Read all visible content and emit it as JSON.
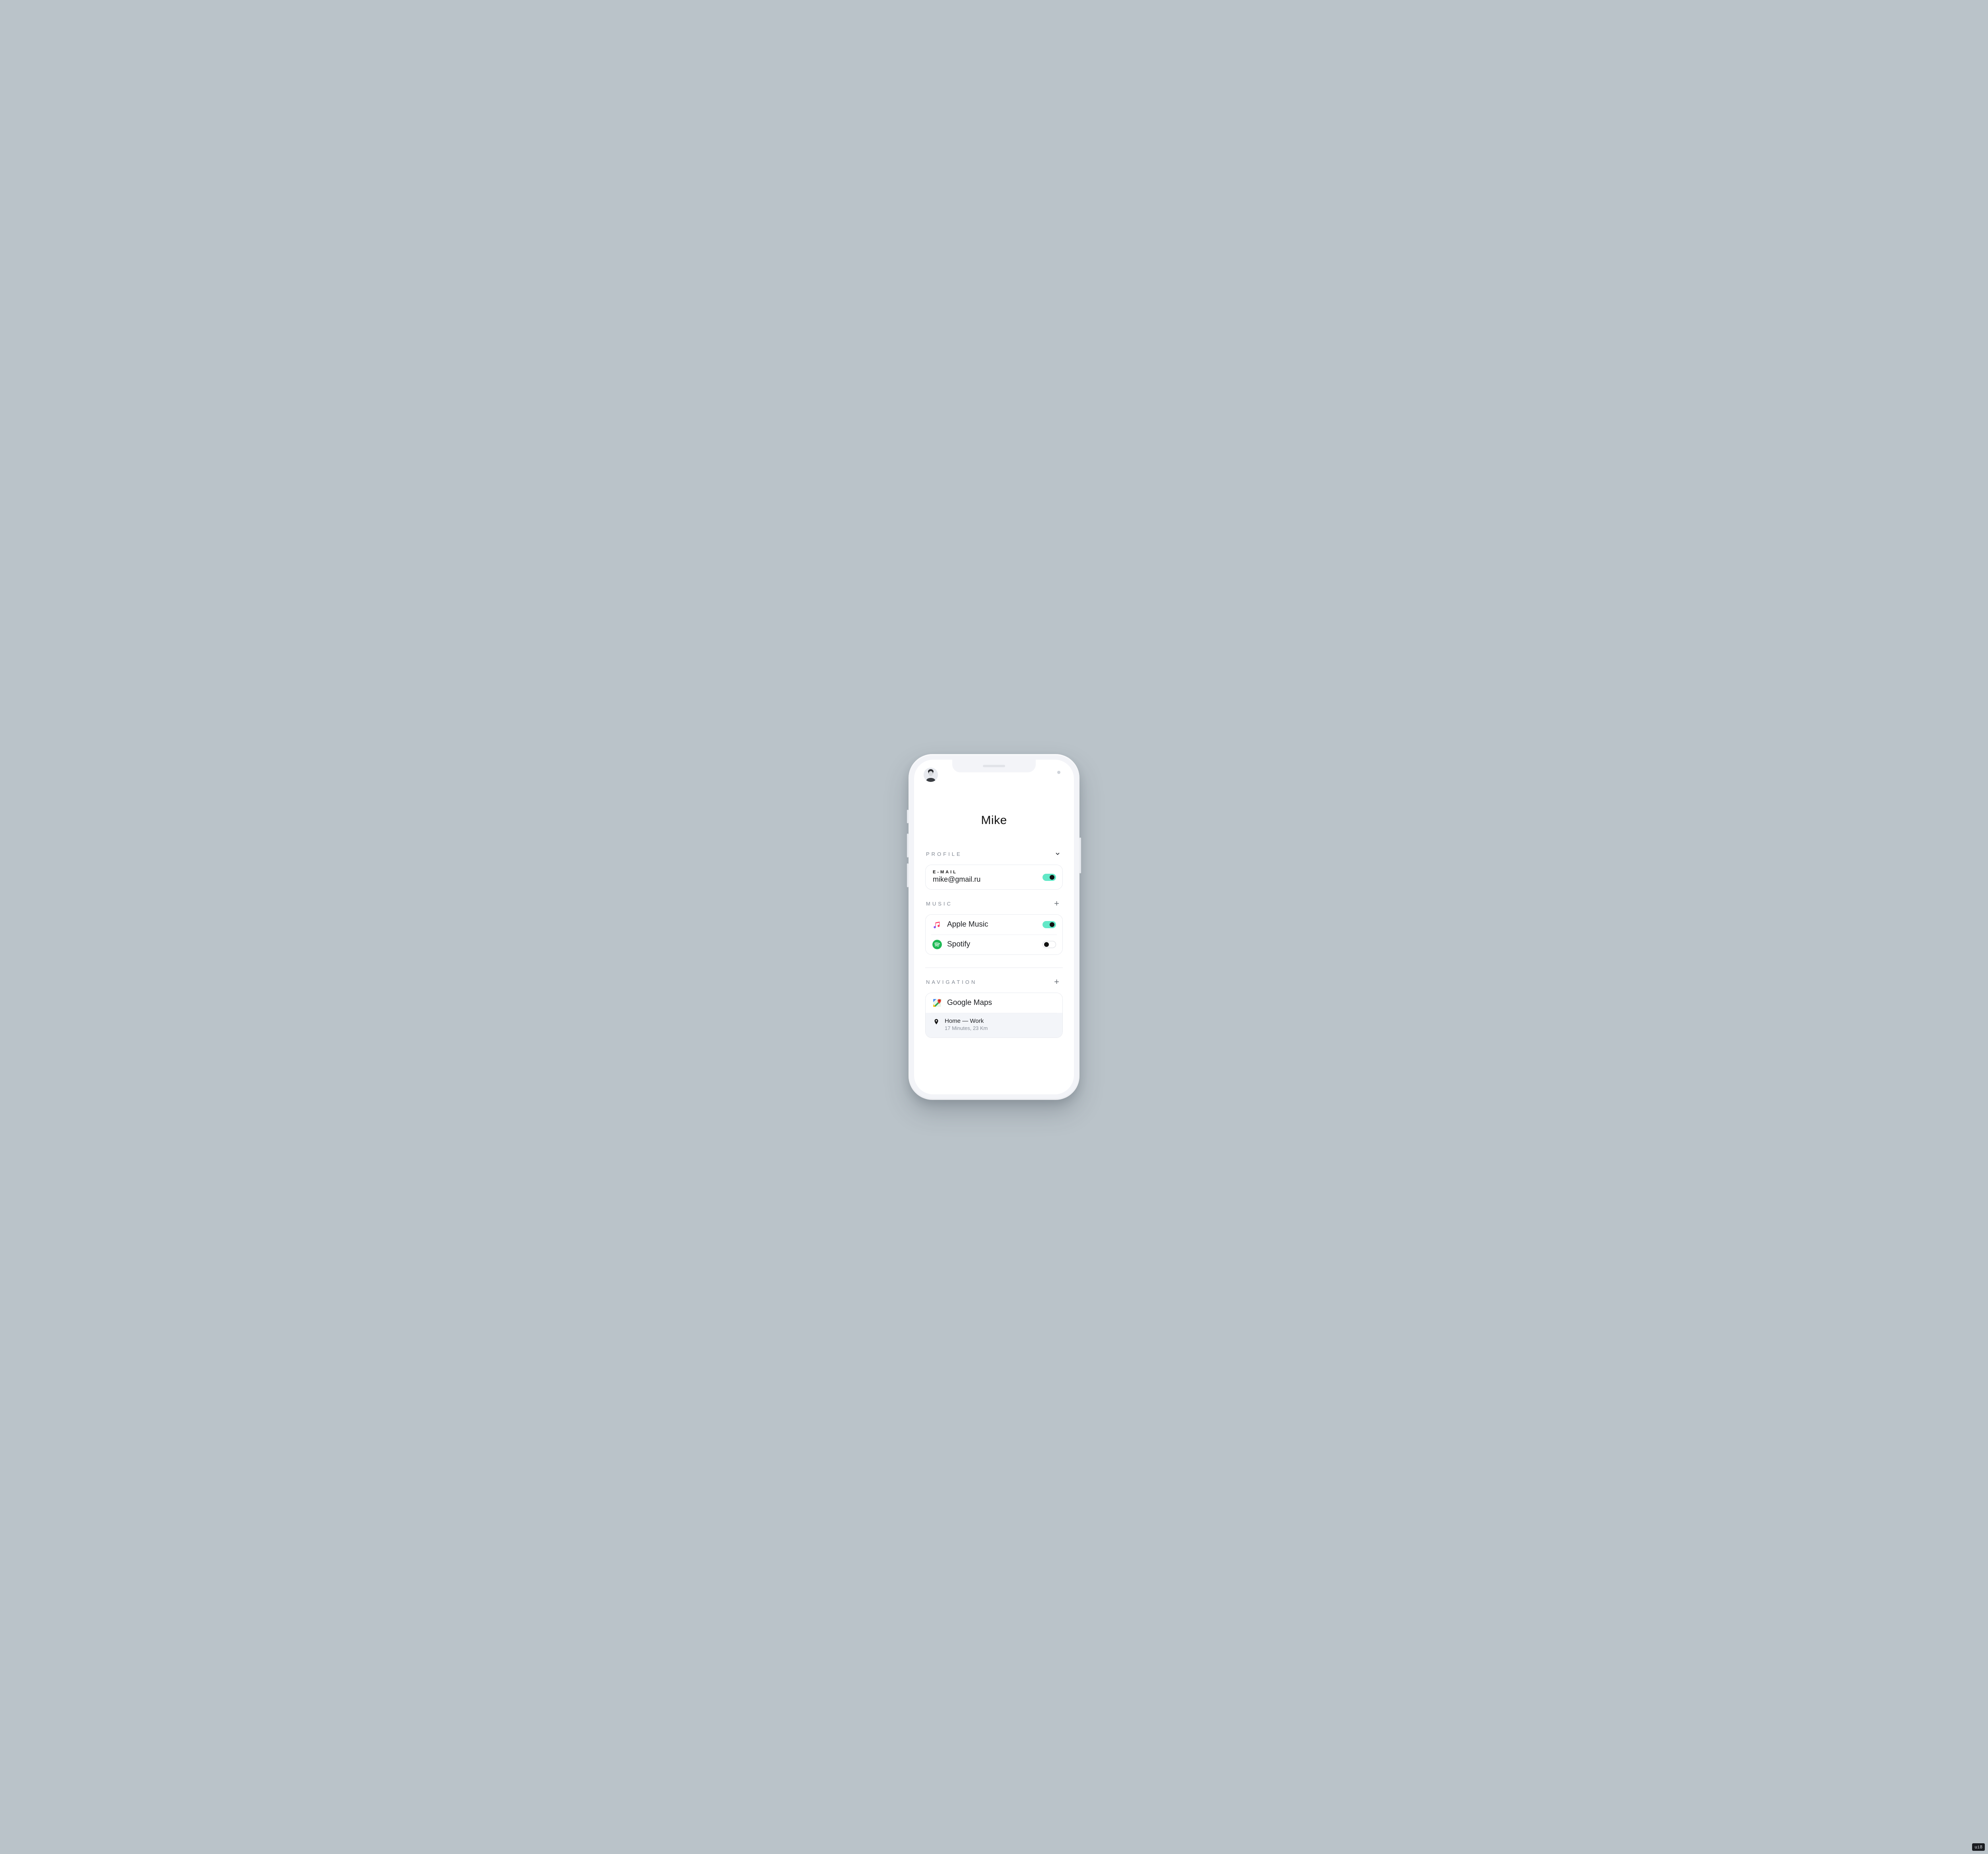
{
  "title": "Mike",
  "sections": {
    "profile": {
      "label": "PROFILE",
      "email_label": "E-MAIL",
      "email_value": "mike@gmail.ru",
      "email_toggle": "on"
    },
    "music": {
      "label": "MUSIC",
      "items": [
        {
          "icon": "apple-music",
          "name": "Apple Music",
          "toggle": "on"
        },
        {
          "icon": "spotify",
          "name": "Spotify",
          "toggle": "off"
        }
      ]
    },
    "navigation": {
      "label": "NAVIGATION",
      "items": [
        {
          "icon": "google-maps",
          "name": "Google Maps",
          "route_label": "Home — Work",
          "route_detail": "17 Minutes, 23 Km"
        }
      ]
    }
  },
  "badge": "ui8"
}
